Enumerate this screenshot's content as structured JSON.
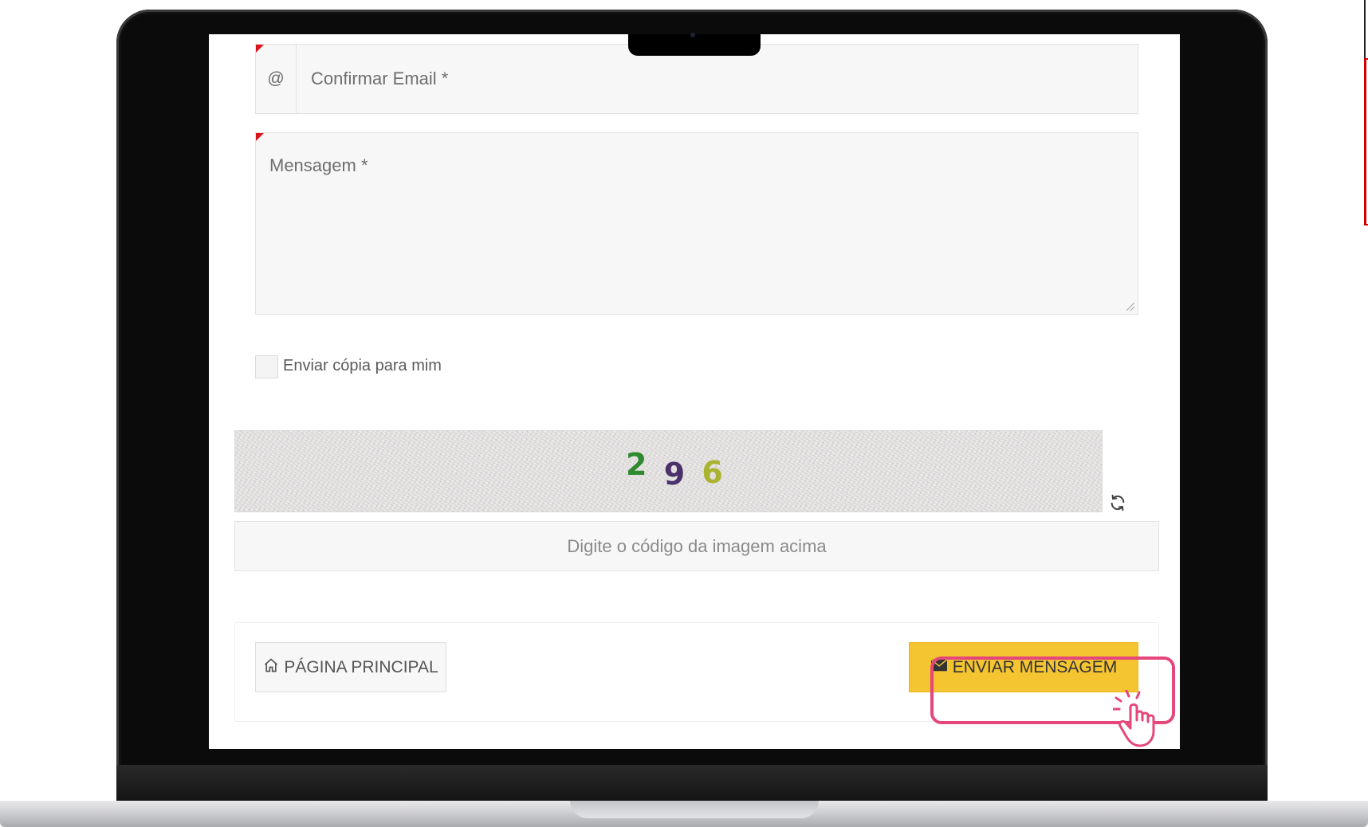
{
  "form": {
    "email_addon": "@",
    "confirm_email_placeholder": "Confirmar Email *",
    "message_placeholder": "Mensagem *",
    "copy_checkbox_label": "Enviar cópia para mim",
    "captcha": {
      "digits": [
        "2",
        "9",
        "6"
      ],
      "colors": [
        "#2f8a2f",
        "#4b3169",
        "#a9b32f"
      ]
    },
    "captcha_input_placeholder": "Digite o código da imagem acima"
  },
  "buttons": {
    "home_label": "PÁGINA PRINCIPAL",
    "send_label": "ENVIAR MENSAGEM"
  },
  "icons": {
    "home": "home-icon",
    "send": "envelope-icon",
    "refresh": "refresh-icon",
    "cursor": "hand-pointer-icon"
  },
  "colors": {
    "required_flag": "#d9141b",
    "send_button": "#f5c431",
    "highlight": "#e5477a"
  }
}
